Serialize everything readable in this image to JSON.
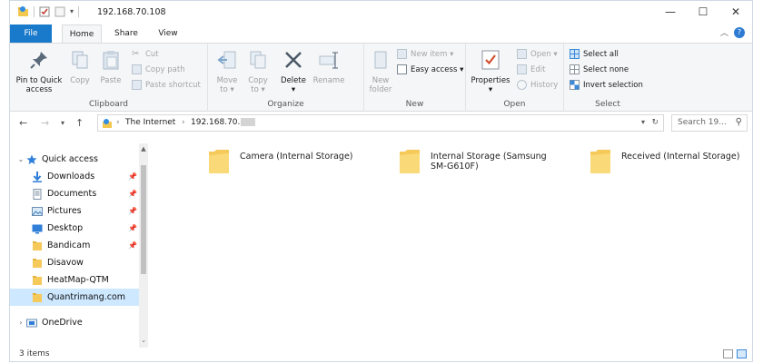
{
  "window": {
    "title": "192.168.70.108",
    "minimize": "—",
    "maximize": "☐",
    "close": "✕"
  },
  "tabs": {
    "file": "File",
    "home": "Home",
    "share": "Share",
    "view": "View"
  },
  "ribbon": {
    "clipboard": {
      "label": "Clipboard",
      "pin_line1": "Pin to Quick",
      "pin_line2": "access",
      "copy": "Copy",
      "paste": "Paste",
      "cut": "Cut",
      "copy_path": "Copy path",
      "paste_shortcut": "Paste shortcut"
    },
    "organize": {
      "label": "Organize",
      "move_to_1": "Move",
      "move_to_2": "to ▾",
      "copy_to_1": "Copy",
      "copy_to_2": "to ▾",
      "delete": "Delete",
      "delete_arrow": "▾",
      "rename": "Rename"
    },
    "new": {
      "label": "New",
      "new_folder_1": "New",
      "new_folder_2": "folder",
      "new_item": "New item ▾",
      "easy_access": "Easy access ▾"
    },
    "open": {
      "label": "Open",
      "properties": "Properties",
      "properties_arrow": "▾",
      "open": "Open ▾",
      "edit": "Edit",
      "history": "History"
    },
    "select": {
      "label": "Select",
      "select_all": "Select all",
      "select_none": "Select none",
      "invert_selection": "Invert selection"
    }
  },
  "address": {
    "crumb1": "The Internet",
    "crumb2": "192.168.70.",
    "search_placeholder": "Search 19..."
  },
  "nav": {
    "items": [
      {
        "label": "Quick access",
        "icon": "star-icon",
        "pinned": false
      },
      {
        "label": "Downloads",
        "icon": "download-icon",
        "pinned": true
      },
      {
        "label": "Documents",
        "icon": "document-icon",
        "pinned": true
      },
      {
        "label": "Pictures",
        "icon": "pictures-icon",
        "pinned": true
      },
      {
        "label": "Desktop",
        "icon": "desktop-icon",
        "pinned": true
      },
      {
        "label": "Bandicam",
        "icon": "folder-icon",
        "pinned": true
      },
      {
        "label": "Disavow",
        "icon": "folder-icon",
        "pinned": false
      },
      {
        "label": "HeatMap-QTM",
        "icon": "folder-icon",
        "pinned": false
      },
      {
        "label": "Quantrimang.com",
        "icon": "folder-icon",
        "pinned": false
      },
      {
        "label": "OneDrive",
        "icon": "onedrive-icon",
        "pinned": false
      }
    ]
  },
  "files": [
    {
      "name": "Camera (Internal Storage)"
    },
    {
      "name": "Internal Storage (Samsung SM-G610F)"
    },
    {
      "name": "Received (Internal Storage)"
    }
  ],
  "status": {
    "count": "3 items"
  },
  "colors": {
    "accent": "#1979ca",
    "folder": "#f5c95a",
    "selection": "#cde8ff"
  }
}
